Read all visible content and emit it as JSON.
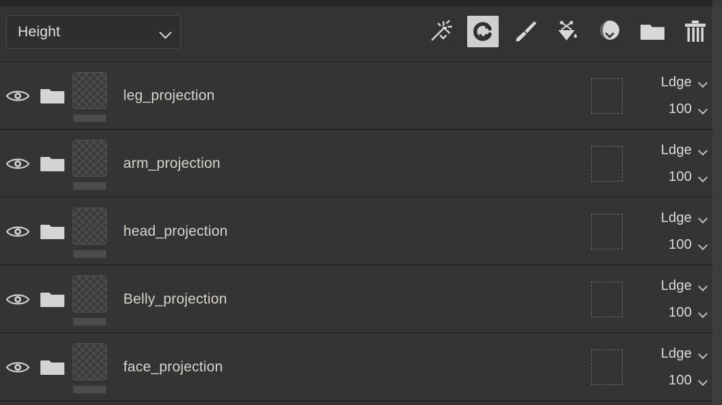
{
  "panel": {
    "name": "layers-panel",
    "background_color": "#333333",
    "row_color": "#343434",
    "text_color": "#d6d3ca",
    "accent_border": "#4a4a4a"
  },
  "header": {
    "mode_select": {
      "value": "Height",
      "icon": "chevron-down-icon"
    },
    "tools": [
      {
        "name": "magic-wand-tool",
        "icon": "magic-wand-icon",
        "selected": false
      },
      {
        "name": "transform-tool",
        "icon": "refresh-icon",
        "selected": true
      },
      {
        "name": "brush-tool",
        "icon": "paintbrush-icon",
        "selected": false
      },
      {
        "name": "fill-tool",
        "icon": "paint-bucket-icon",
        "selected": false
      },
      {
        "name": "material-tool",
        "icon": "sphere-icon",
        "selected": false
      },
      {
        "name": "new-folder-tool",
        "icon": "folder-icon",
        "selected": false
      },
      {
        "name": "delete-layer-tool",
        "icon": "trash-icon",
        "selected": false
      }
    ]
  },
  "layers": [
    {
      "name": "leg_projection",
      "visible": true,
      "visibility_icon": "eye-icon",
      "group_icon": "folder-icon",
      "thumbnail": "transparent-checkerboard",
      "mask": "empty-mask",
      "blend_mode": "Ldge",
      "opacity": "100"
    },
    {
      "name": "arm_projection",
      "visible": true,
      "visibility_icon": "eye-icon",
      "group_icon": "folder-icon",
      "thumbnail": "transparent-checkerboard",
      "mask": "empty-mask",
      "blend_mode": "Ldge",
      "opacity": "100"
    },
    {
      "name": "head_projection",
      "visible": true,
      "visibility_icon": "eye-icon",
      "group_icon": "folder-icon",
      "thumbnail": "transparent-checkerboard",
      "mask": "empty-mask",
      "blend_mode": "Ldge",
      "opacity": "100"
    },
    {
      "name": "Belly_projection",
      "visible": true,
      "visibility_icon": "eye-icon",
      "group_icon": "folder-icon",
      "thumbnail": "transparent-checkerboard",
      "mask": "empty-mask",
      "blend_mode": "Ldge",
      "opacity": "100"
    },
    {
      "name": "face_projection",
      "visible": true,
      "visibility_icon": "eye-icon",
      "group_icon": "folder-icon",
      "thumbnail": "transparent-checkerboard",
      "mask": "empty-mask",
      "blend_mode": "Ldge",
      "opacity": "100"
    }
  ],
  "scrollbar": {
    "name": "vertical-scrollbar",
    "orientation": "vertical"
  }
}
